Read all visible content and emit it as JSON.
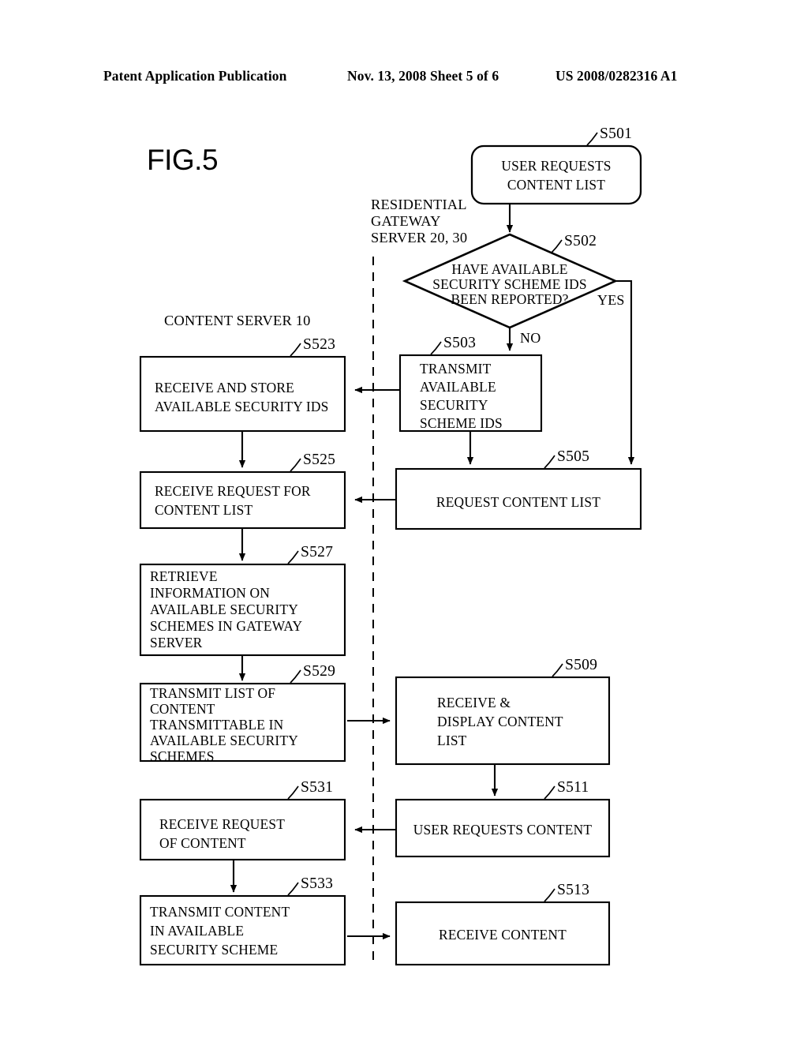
{
  "header": {
    "left": "Patent Application Publication",
    "middle": "Nov. 13, 2008  Sheet 5 of 6",
    "right": "US 2008/0282316 A1"
  },
  "figure": {
    "label": "FIG.5"
  },
  "lanes": [
    {
      "name": "content-server",
      "lines": [
        "CONTENT SERVER 10"
      ]
    },
    {
      "name": "residential-gateway-server",
      "lines": [
        "RESIDENTIAL",
        "GATEWAY",
        "SERVER  20, 30"
      ]
    }
  ],
  "branch_labels": {
    "yes": "YES",
    "no": "NO"
  },
  "nodes": [
    {
      "id": "S501",
      "shape": "rounded-rect",
      "lines": [
        "USER REQUESTS",
        "CONTENT LIST"
      ]
    },
    {
      "id": "S502",
      "shape": "diamond",
      "lines": [
        "HAVE AVAILABLE",
        "SECURITY SCHEME IDS",
        "BEEN REPORTED?"
      ]
    },
    {
      "id": "S503",
      "shape": "rect",
      "lines": [
        "TRANSMIT",
        "AVAILABLE",
        "SECURITY",
        "SCHEME IDS"
      ]
    },
    {
      "id": "S505",
      "shape": "rect",
      "lines": [
        "REQUEST CONTENT LIST"
      ]
    },
    {
      "id": "S509",
      "shape": "rect",
      "lines": [
        "RECEIVE &",
        "DISPLAY CONTENT",
        "LIST"
      ]
    },
    {
      "id": "S511",
      "shape": "rect",
      "lines": [
        "USER REQUESTS CONTENT"
      ]
    },
    {
      "id": "S513",
      "shape": "rect",
      "lines": [
        "RECEIVE CONTENT"
      ]
    },
    {
      "id": "S523",
      "shape": "rect",
      "lines": [
        "RECEIVE AND STORE",
        "AVAILABLE SECURITY IDS"
      ]
    },
    {
      "id": "S525",
      "shape": "rect",
      "lines": [
        "RECEIVE REQUEST FOR",
        "CONTENT LIST"
      ]
    },
    {
      "id": "S527",
      "shape": "rect",
      "lines": [
        "RETRIEVE",
        "INFORMATION ON",
        "AVAILABLE SECURITY",
        "SCHEMES IN GATEWAY",
        "SERVER"
      ]
    },
    {
      "id": "S529",
      "shape": "rect",
      "lines": [
        "TRANSMIT LIST OF",
        "CONTENT",
        "TRANSMITTABLE IN",
        "AVAILABLE SECURITY",
        "SCHEMES"
      ]
    },
    {
      "id": "S531",
      "shape": "rect",
      "lines": [
        "RECEIVE REQUEST",
        "OF CONTENT"
      ]
    },
    {
      "id": "S533",
      "shape": "rect",
      "lines": [
        "TRANSMIT CONTENT",
        "IN AVAILABLE",
        "SECURITY SCHEME"
      ]
    }
  ],
  "colors": {
    "ink": "#000000",
    "paper": "#ffffff"
  }
}
